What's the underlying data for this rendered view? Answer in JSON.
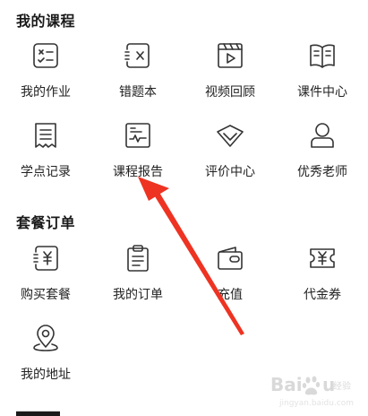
{
  "sections": {
    "courses": {
      "title": "我的课程",
      "items": [
        {
          "label": "我的作业",
          "icon": "homework-icon"
        },
        {
          "label": "错题本",
          "icon": "wrong-questions-icon"
        },
        {
          "label": "视频回顾",
          "icon": "video-review-icon"
        },
        {
          "label": "课件中心",
          "icon": "courseware-icon"
        },
        {
          "label": "学点记录",
          "icon": "study-record-icon"
        },
        {
          "label": "课程报告",
          "icon": "course-report-icon"
        },
        {
          "label": "评价中心",
          "icon": "evaluation-icon"
        },
        {
          "label": "优秀老师",
          "icon": "teacher-icon"
        }
      ]
    },
    "orders": {
      "title": "套餐订单",
      "items": [
        {
          "label": "购买套餐",
          "icon": "buy-package-icon"
        },
        {
          "label": "我的订单",
          "icon": "order-clipboard-icon"
        },
        {
          "label": "充值",
          "icon": "wallet-icon"
        },
        {
          "label": "代金券",
          "icon": "voucher-icon"
        },
        {
          "label": "我的地址",
          "icon": "location-pin-icon"
        }
      ]
    }
  },
  "annotation": {
    "arrow_color": "#ee3322"
  },
  "colors": {
    "icon_stroke": "#333333",
    "text": "#222222"
  }
}
